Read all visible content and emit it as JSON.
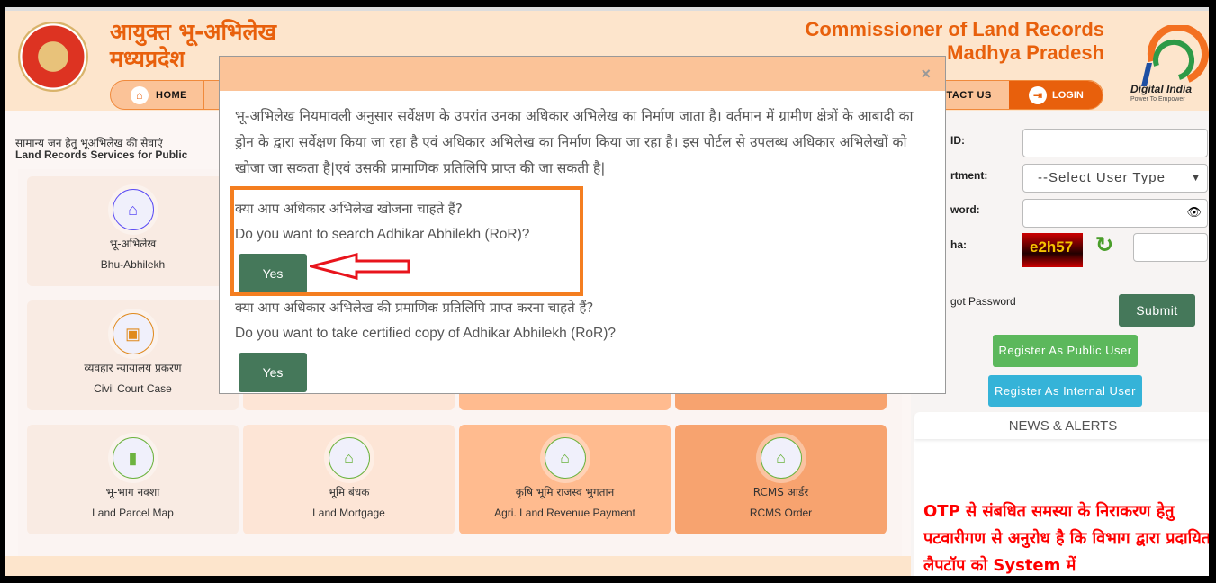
{
  "header": {
    "title_hi_1": "आयुक्त भू-अभिलेख",
    "title_hi_2": "मध्यप्रदेश",
    "title_en_1": "Commissioner of Land Records",
    "title_en_2": "Madhya Pradesh",
    "digital_india": "Digital India",
    "digital_india_tag": "Power To Empower"
  },
  "nav": {
    "home": "HOME",
    "contact": "NTACT US",
    "login": "LOGIN"
  },
  "services": {
    "heading_hi": "सामान्य जन हेतु भूअभिलेख की सेवाएं",
    "heading_en": "Land Records Services for Public",
    "tiles": [
      {
        "hi": "भू-अभिलेख",
        "en": "Bhu-Abhilekh",
        "icon": "house-heart-icon",
        "color": "#5b4cf5"
      },
      {
        "hi": "व्यवहार न्यायालय प्रकरण",
        "en": "Civil Court Case",
        "icon": "court-icon",
        "color": "#e08a1e"
      },
      {
        "hi": "भू-भाग नक्शा",
        "en": "Land Parcel Map",
        "icon": "book-icon",
        "color": "#6cb33f"
      },
      {
        "hi": "भूमि बंधक",
        "en": "Land Mortgage",
        "icon": "house-heart-icon",
        "color": "#6cb33f"
      },
      {
        "hi": "कृषि भूमि राजस्व भुगतान",
        "en": "Agri. Land Revenue Payment",
        "icon": "house-heart-icon",
        "color": "#6cb33f"
      },
      {
        "hi": "RCMS आर्डर",
        "en": "RCMS Order",
        "icon": "house-heart-icon",
        "color": "#6cb33f"
      }
    ]
  },
  "login": {
    "id_label": "ID:",
    "dept_label": "rtment:",
    "dept_value": "--Select User Type",
    "password_label": "word:",
    "captcha_label": "ha:",
    "captcha_text": "e2h57",
    "forgot": "got Password",
    "submit": "Submit",
    "register_public": "Register As Public User",
    "register_internal": "Register As Internal User"
  },
  "news": {
    "heading": "NEWS & ALERTS",
    "text": "OTP से संबधित समस्या के निराकरण हेतु पटवारीगण से अनुरोध है कि विभाग द्वारा प्रदायित लैपटॉप को System में"
  },
  "modal": {
    "close": "×",
    "intro": "भू-अभिलेख नियमावली अनुसार सर्वेक्षण के उपरांत उनका अधिकार अभिलेख का निर्माण जाता है। वर्तमान में ग्रामीण क्षेत्रों के आबादी का ड्रोन के द्वारा सर्वेक्षण किया जा रहा है एवं अधिकार अभिलेख का निर्माण किया जा रहा है। इस पोर्टल से उपलब्ध अधिकार अभिलेखों को खोजा जा सकता है|एवं उसकी प्रामाणिक प्रतिलिपि प्राप्त की जा सकती है|",
    "q1_hi": "क्या आप अधिकार अभिलेख खोजना चाहते हैं?",
    "q1_en": "Do you want to search Adhikar Abhilekh (RoR)?",
    "yes1": "Yes",
    "q2_hi": "क्या आप अधिकार अभिलेख की प्रमाणिक प्रतिलिपि प्राप्त करना चाहते हैं?",
    "q2_en": "Do you want to take certified copy of Adhikar Abhilekh (RoR)?",
    "yes2": "Yes"
  },
  "colors": {
    "brand_orange": "#e8600c",
    "header_bg": "#fde5cc",
    "button_green": "#45785a",
    "highlight": "#f47e20",
    "arrow": "#e8141c"
  }
}
